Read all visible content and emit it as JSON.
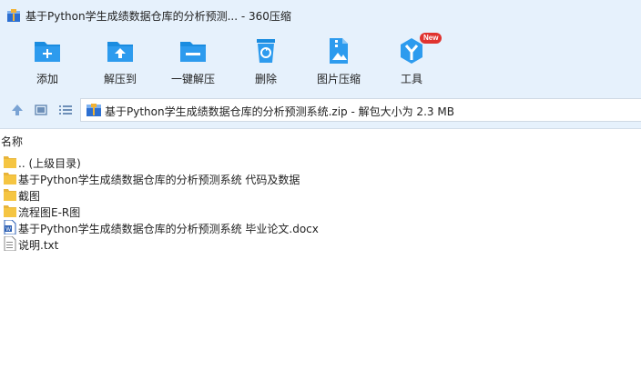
{
  "window": {
    "title": "基于Python学生成绩数据仓库的分析预测... - 360压缩"
  },
  "toolbar": {
    "items": [
      {
        "label": "添加",
        "icon": "add-folder-icon"
      },
      {
        "label": "解压到",
        "icon": "extract-to-icon"
      },
      {
        "label": "一键解压",
        "icon": "one-click-extract-icon"
      },
      {
        "label": "删除",
        "icon": "trash-icon"
      },
      {
        "label": "图片压缩",
        "icon": "image-compress-icon"
      },
      {
        "label": "工具",
        "icon": "tools-icon",
        "badge": "New"
      }
    ]
  },
  "pathbar": {
    "path": "基于Python学生成绩数据仓库的分析预测系统.zip - 解包大小为 2.3 MB"
  },
  "list": {
    "column_name": "名称",
    "rows": [
      {
        "name": ".. (上级目录)",
        "type": "folder"
      },
      {
        "name": "基于Python学生成绩数据仓库的分析预测系统 代码及数据",
        "type": "folder"
      },
      {
        "name": "截图",
        "type": "folder"
      },
      {
        "name": "流程图E-R图",
        "type": "folder"
      },
      {
        "name": "基于Python学生成绩数据仓库的分析预测系统 毕业论文.docx",
        "type": "docx"
      },
      {
        "name": "说明.txt",
        "type": "txt"
      }
    ]
  },
  "colors": {
    "accent": "#1a8ce0",
    "toolbar_bg": "#e6f1fc",
    "folder": "#f5c542",
    "badge": "#e0332f"
  }
}
